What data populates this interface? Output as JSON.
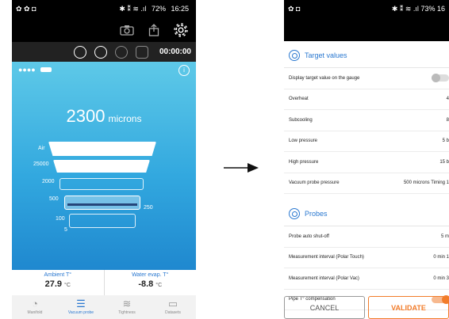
{
  "left": {
    "status": {
      "icons_left": "✿ ✿ ◘",
      "icons_right": "✱ ⁑ ≋ .ıl",
      "battery": "72%",
      "time": "16:25"
    },
    "timer": "00:00:00",
    "reading": {
      "value": "2300",
      "unit": "microns"
    },
    "gauge_labels": [
      "Air",
      "25000",
      "2000",
      "500",
      "100",
      "5"
    ],
    "gauge_side_label": "250",
    "readouts": [
      {
        "label": "Ambient T°",
        "value": "27.9",
        "unit": "°C"
      },
      {
        "label": "Water evap. T°",
        "value": "-8.8",
        "unit": "°C"
      }
    ],
    "nav": [
      {
        "label": "Manifold",
        "icon": "gauge-icon"
      },
      {
        "label": "Vacuum probe",
        "icon": "vacuum-probe-icon"
      },
      {
        "label": "Tightness",
        "icon": "tightness-icon"
      },
      {
        "label": "Datasets",
        "icon": "datasets-icon"
      }
    ]
  },
  "right": {
    "status": {
      "icons_left": "✿ ◘",
      "icons_right": "✱ ⁑ ≋ .ıl",
      "battery": "73%",
      "time": "16"
    },
    "section1": "Target values",
    "rows1": [
      {
        "label": "Display target value on the gauge",
        "value": ""
      },
      {
        "label": "Overheat",
        "value": "4"
      },
      {
        "label": "Subcooling",
        "value": "8"
      },
      {
        "label": "Low pressure",
        "value": "5 b"
      },
      {
        "label": "High pressure",
        "value": "15 b"
      },
      {
        "label": "Vacuum probe pressure",
        "value": "500 microns   Timing   1"
      }
    ],
    "section2": "Probes",
    "rows2": [
      {
        "label": "Probe auto shut-off",
        "value": "5 m"
      },
      {
        "label": "Measurement interval (Polar Touch)",
        "value": "0 min 1"
      },
      {
        "label": "Measurement interval (Polar Vac)",
        "value": "0 min 3"
      },
      {
        "label": "Pipe T° compensation",
        "value": ""
      }
    ],
    "buttons": {
      "cancel": "CANCEL",
      "validate": "VALIDATE"
    }
  }
}
